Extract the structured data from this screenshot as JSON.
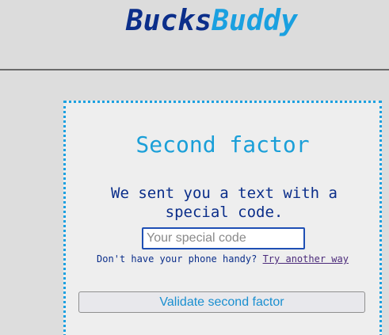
{
  "header": {
    "logo_part1": "Bucks",
    "logo_part2": "Buddy"
  },
  "colors": {
    "brand_dark": "#0b2e8a",
    "brand_light": "#1aa0e0",
    "card_border": "#1aa0e0"
  },
  "form": {
    "title": "Second factor",
    "message": "We sent you a text with a special code.",
    "code_input": {
      "value": "",
      "placeholder": "Your special code"
    },
    "alt_prompt": "Don't have your phone handy?",
    "alt_link": "Try another way",
    "validate_button": "Validate second factor"
  }
}
